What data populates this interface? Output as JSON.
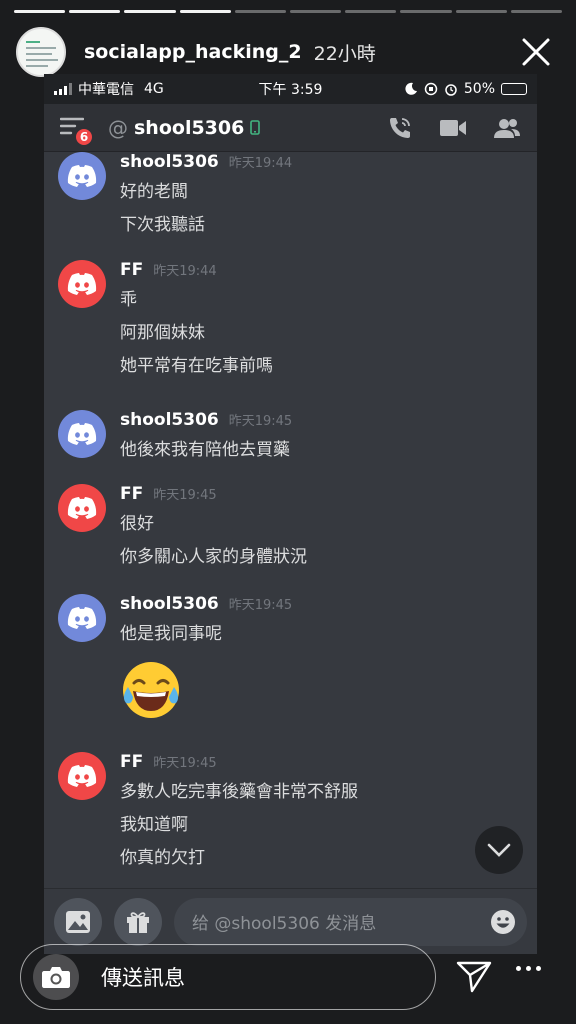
{
  "story": {
    "username": "socialapp_hacking_2",
    "time_ago": "22小時",
    "segments_total": 10,
    "segments_done": 4,
    "reply_placeholder": "傳送訊息"
  },
  "status_bar": {
    "carrier": "中華電信",
    "network": "4G",
    "time": "下午 3:59",
    "battery": "50%",
    "battery_level": 0.5
  },
  "chat_header": {
    "at_symbol": "@",
    "title": "shool5306",
    "menu_badge": "6",
    "icons": [
      "menu-icon",
      "phone-call-icon",
      "video-call-icon",
      "members-icon"
    ]
  },
  "messages": [
    {
      "author": "shool5306",
      "timestamp": "昨天19:44",
      "avatar_color": "#7289da",
      "lines": [
        "好的老闆",
        "下次我聽話"
      ]
    },
    {
      "author": "FF",
      "timestamp": "昨天19:44",
      "avatar_color": "#f04747",
      "lines": [
        "乖",
        "阿那個妹妹",
        "她平常有在吃事前嗎"
      ]
    },
    {
      "author": "shool5306",
      "timestamp": "昨天19:45",
      "avatar_color": "#7289da",
      "lines": [
        "他後來我有陪他去買藥"
      ]
    },
    {
      "author": "FF",
      "timestamp": "昨天19:45",
      "avatar_color": "#f04747",
      "lines": [
        "很好",
        "你多關心人家的身體狀況"
      ]
    },
    {
      "author": "shool5306",
      "timestamp": "昨天19:45",
      "avatar_color": "#7289da",
      "lines": [
        "他是我同事呢"
      ],
      "emoji": "face-with-tears-of-joy"
    },
    {
      "author": "FF",
      "timestamp": "昨天19:45",
      "avatar_color": "#f04747",
      "lines": [
        "多數人吃完事後藥會非常不舒服",
        "我知道啊",
        "你真的欠打"
      ]
    }
  ],
  "composer": {
    "placeholder": "给 @shool5306 发消息",
    "icons": [
      "image-icon",
      "gift-icon",
      "emoji-icon"
    ]
  }
}
